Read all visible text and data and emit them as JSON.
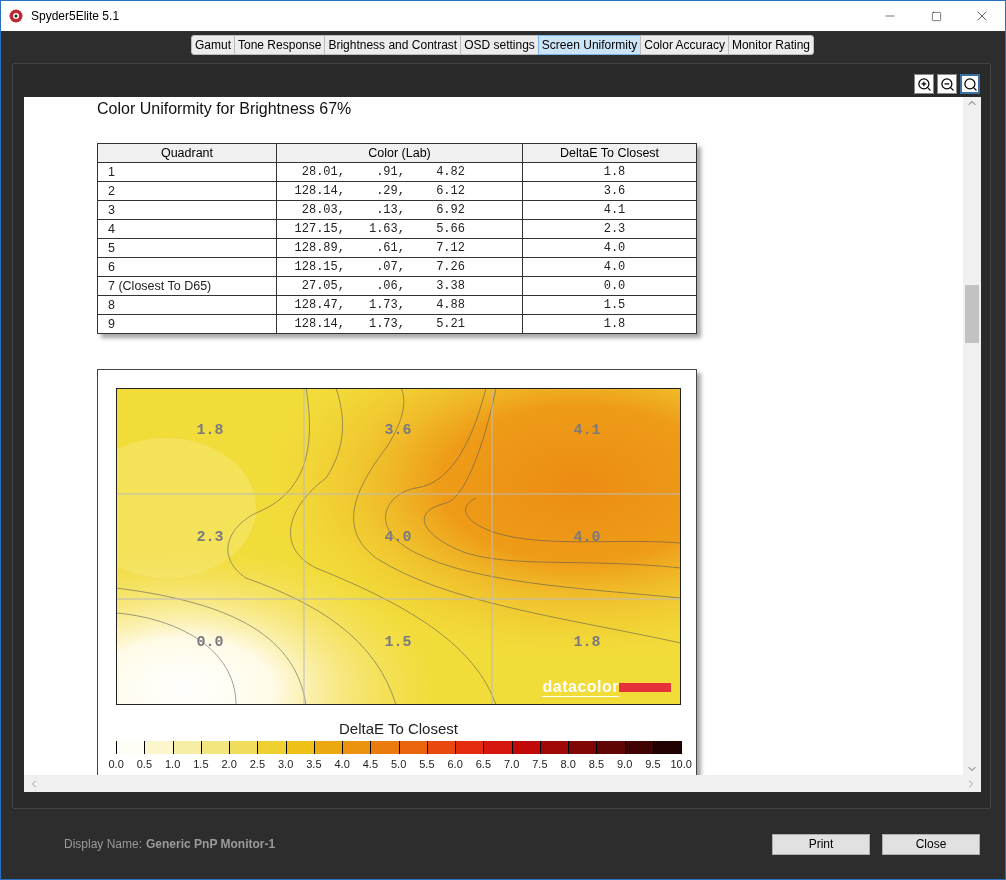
{
  "window": {
    "title": "Spyder5Elite 5.1"
  },
  "tabs": [
    {
      "label": "Gamut",
      "selected": false
    },
    {
      "label": "Tone Response",
      "selected": false
    },
    {
      "label": "Brightness and Contrast",
      "selected": false
    },
    {
      "label": "OSD settings",
      "selected": false
    },
    {
      "label": "Screen Uniformity",
      "selected": true
    },
    {
      "label": "Color Accuracy",
      "selected": false
    },
    {
      "label": "Monitor Rating",
      "selected": false
    }
  ],
  "zoom_tools": [
    {
      "kind": "zoom_in",
      "selected": false
    },
    {
      "kind": "zoom_out",
      "selected": false
    },
    {
      "kind": "fit",
      "selected": true
    }
  ],
  "report": {
    "heading": "Color Uniformity for Brightness 67%",
    "table": {
      "columns": [
        "Quadrant",
        "Color (Lab)",
        "DeltaE To Closest"
      ],
      "rows": [
        {
          "quadrant": "1",
          "lab": [
            "28.01,",
            ".91,",
            "4.82"
          ],
          "delta_e": "1.8"
        },
        {
          "quadrant": "2",
          "lab": [
            "128.14,",
            ".29,",
            "6.12"
          ],
          "delta_e": "3.6"
        },
        {
          "quadrant": "3",
          "lab": [
            "28.03,",
            ".13,",
            "6.92"
          ],
          "delta_e": "4.1"
        },
        {
          "quadrant": "4",
          "lab": [
            "127.15,",
            "1.63,",
            "5.66"
          ],
          "delta_e": "2.3"
        },
        {
          "quadrant": "5",
          "lab": [
            "128.89,",
            ".61,",
            "7.12"
          ],
          "delta_e": "4.0"
        },
        {
          "quadrant": "6",
          "lab": [
            "128.15,",
            ".07,",
            "7.26"
          ],
          "delta_e": "4.0"
        },
        {
          "quadrant": "7 (Closest To D65)",
          "lab": [
            "27.05,",
            ".06,",
            "3.38"
          ],
          "delta_e": "0.0"
        },
        {
          "quadrant": "8",
          "lab": [
            "128.47,",
            "1.73,",
            "4.88"
          ],
          "delta_e": "1.5"
        },
        {
          "quadrant": "9",
          "lab": [
            "128.14,",
            "1.73,",
            "5.21"
          ],
          "delta_e": "1.8"
        }
      ]
    },
    "uniformity_map": {
      "cell_values": [
        [
          "1.8",
          "3.6",
          "4.1"
        ],
        [
          "2.3",
          "4.0",
          "4.0"
        ],
        [
          "0.0",
          "1.5",
          "1.8"
        ]
      ],
      "logo": "datacolor",
      "legend": {
        "title": "DeltaE To Closest",
        "ticks": [
          "0.0",
          "0.5",
          "1.0",
          "1.5",
          "2.0",
          "2.5",
          "3.0",
          "3.5",
          "4.0",
          "4.5",
          "5.0",
          "5.5",
          "6.0",
          "6.5",
          "7.0",
          "7.5",
          "8.0",
          "8.5",
          "9.0",
          "9.5",
          "10.0"
        ]
      }
    }
  },
  "footer": {
    "display_name_label": "Display Name:",
    "display_name": "Generic PnP Monitor-1",
    "buttons": [
      "Print",
      "Close"
    ]
  }
}
